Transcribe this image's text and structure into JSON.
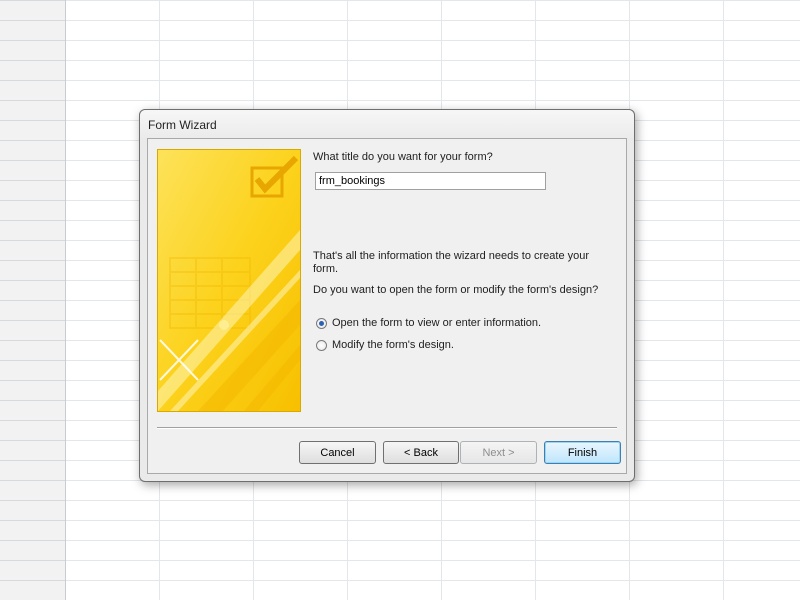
{
  "window": {
    "title": "Form Wizard"
  },
  "form": {
    "question": "What title do you want for your form?",
    "title_value": "frm_bookings",
    "info_text": "That's all the information the wizard needs to create your form.",
    "prompt_text": "Do you want to open the form or modify the form's design?"
  },
  "options": [
    {
      "label": "Open the form to view or enter information.",
      "checked": true
    },
    {
      "label": "Modify the form's design.",
      "checked": false
    }
  ],
  "buttons": {
    "cancel": "Cancel",
    "back": "< Back",
    "next": "Next >",
    "finish": "Finish"
  },
  "colors": {
    "art_yellow": "#fcd21c",
    "art_yellow_light": "#fde66a",
    "art_yellow_dark": "#f5bc00",
    "radio_dot": "#2b62b5",
    "default_button_border": "#3c7fb1"
  },
  "icons": {
    "wizard_art": "checkmark-form-illustration"
  }
}
